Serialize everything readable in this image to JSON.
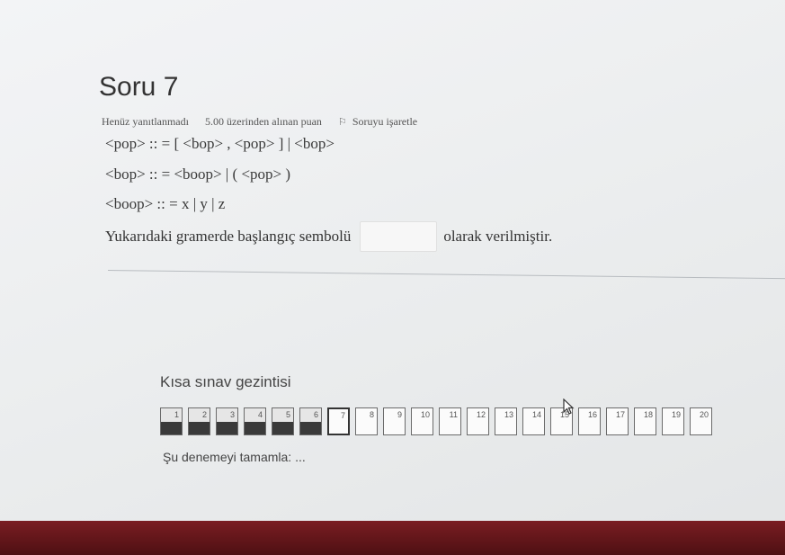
{
  "question": {
    "title": "Soru 7",
    "status": "Henüz yanıtlanmadı",
    "points": "5.00 üzerinden alınan puan",
    "flag_label": "Soruyu işaretle"
  },
  "grammar": [
    "<pop> :: = [ <bop> , <pop> ] | <bop>",
    "<bop> :: = <boop> | ( <pop> )",
    "<boop> :: = x | y | z"
  ],
  "sentence": {
    "before": "Yukarıdaki gramerde başlangıç sembolü",
    "answer_value": "",
    "after": "olarak verilmiştir."
  },
  "navigation": {
    "title": "Kısa sınav gezintisi",
    "questions": [
      "1",
      "2",
      "3",
      "4",
      "5",
      "6",
      "7",
      "8",
      "9",
      "10",
      "11",
      "12",
      "13",
      "14",
      "15",
      "16",
      "17",
      "18",
      "19",
      "20"
    ],
    "answered_count": 6,
    "current": 7,
    "finish_label": "Şu denemeyi tamamla: ..."
  },
  "colors": {
    "bottom_bar": "#6a171b"
  }
}
